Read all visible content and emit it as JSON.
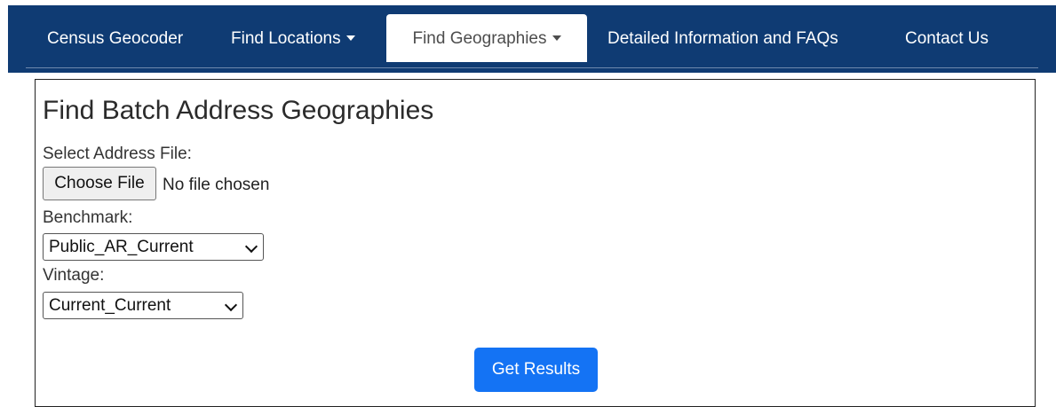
{
  "nav": {
    "brand": "Census Geocoder",
    "find_locations": "Find Locations",
    "find_geographies": "Find Geographies",
    "details_faqs": "Detailed Information and FAQs",
    "contact": "Contact Us"
  },
  "form": {
    "title": "Find Batch Address Geographies",
    "file_label": "Select Address File:",
    "file_button": "Choose File",
    "file_status": "No file chosen",
    "benchmark_label": "Benchmark:",
    "benchmark_value": "Public_AR_Current",
    "vintage_label": "Vintage:",
    "vintage_value": "Current_Current",
    "submit_label": "Get Results"
  },
  "colors": {
    "navbar": "#0f3b73",
    "active_tab": "#ffffff",
    "primary_button": "#1473f4"
  },
  "icons": {
    "dropdown": "caret-down-icon",
    "select": "chevron-down-icon"
  }
}
